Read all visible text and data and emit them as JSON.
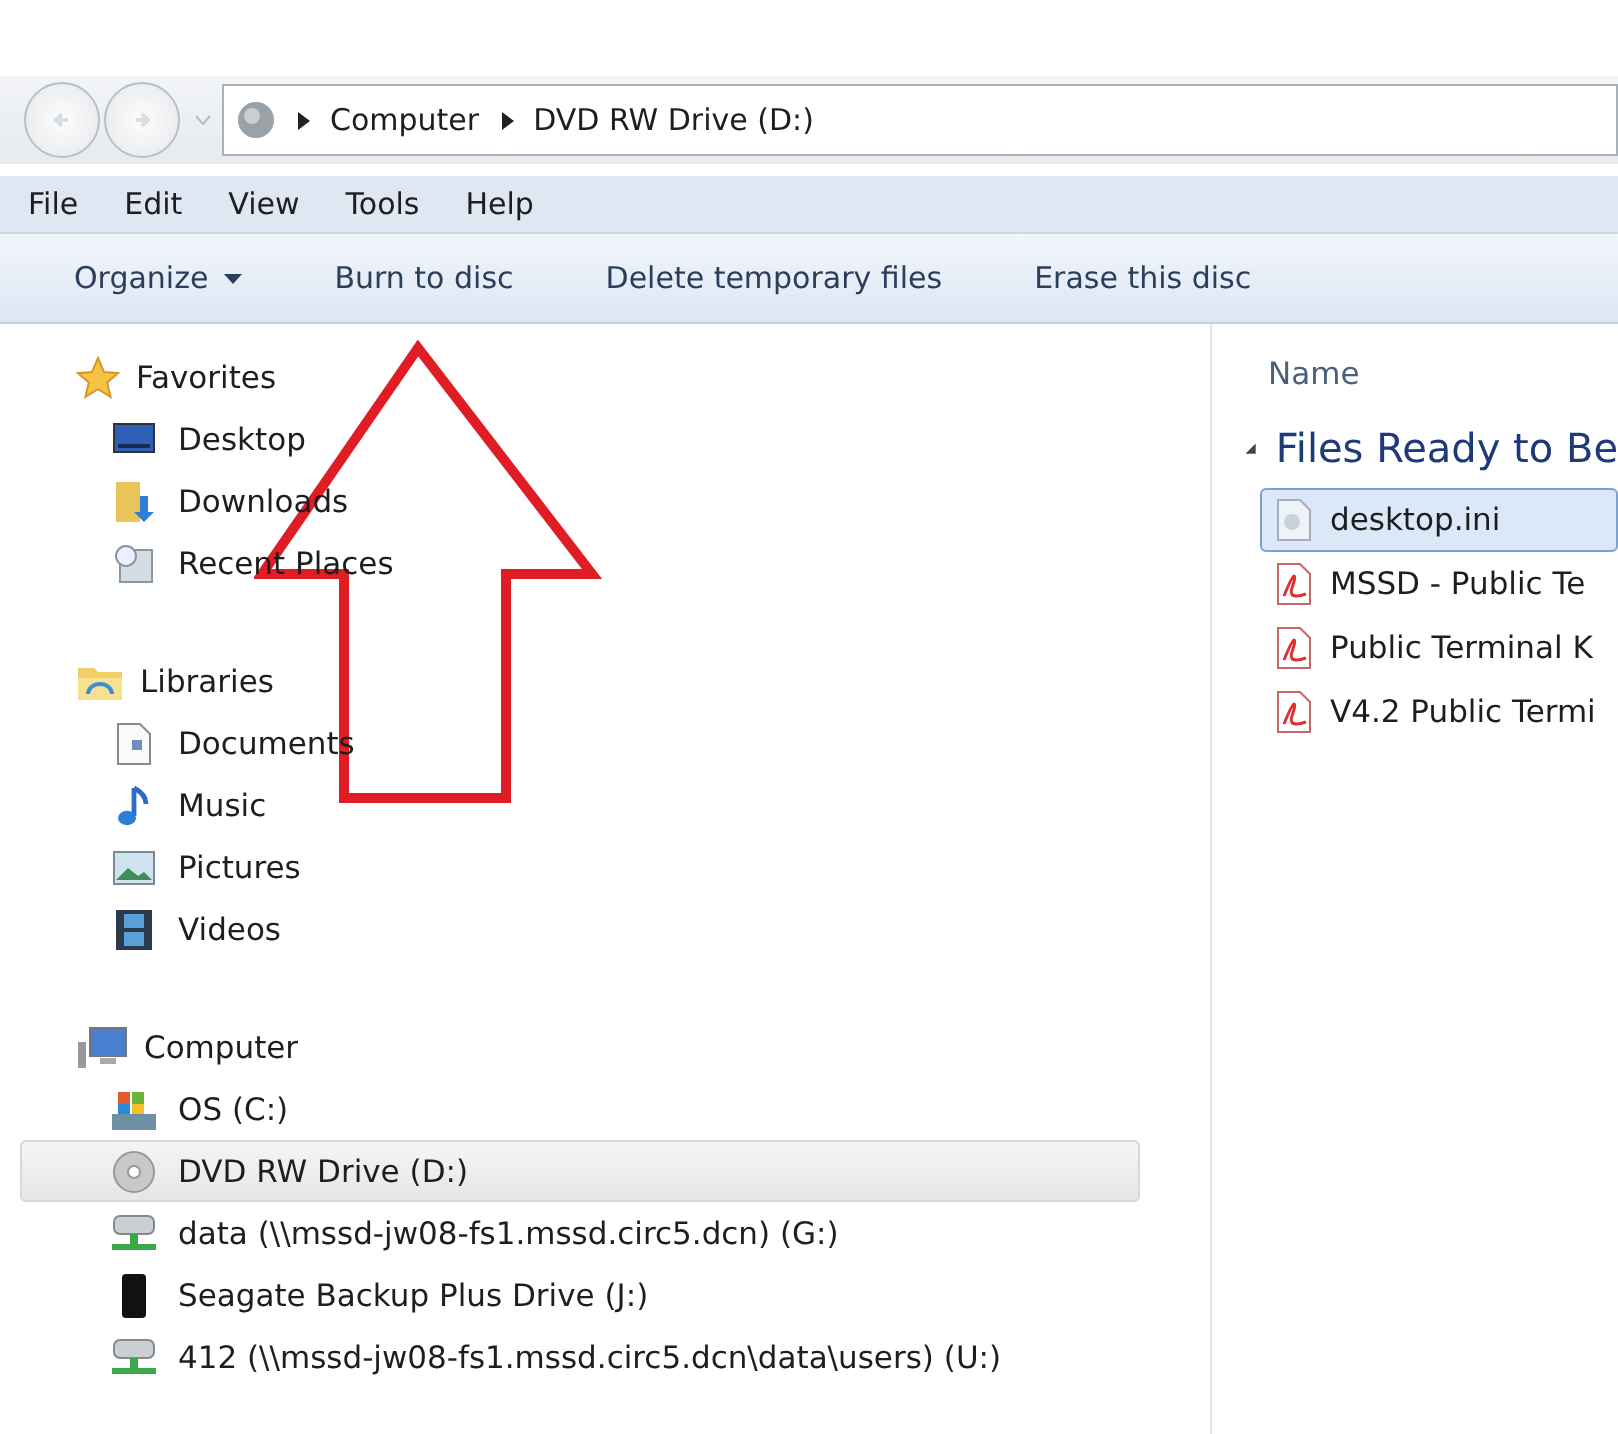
{
  "address_bar": {
    "crumbs": [
      "Computer",
      "DVD RW Drive (D:)"
    ]
  },
  "menu_bar": [
    "File",
    "Edit",
    "View",
    "Tools",
    "Help"
  ],
  "toolbar": [
    {
      "label": "Organize",
      "dropdown": true
    },
    {
      "label": "Burn to disc",
      "dropdown": false
    },
    {
      "label": "Delete temporary files",
      "dropdown": false
    },
    {
      "label": "Erase this disc",
      "dropdown": false
    }
  ],
  "sidebar": {
    "sections": [
      {
        "label": "Favorites",
        "children": [
          {
            "label": "Desktop",
            "selected": false
          },
          {
            "label": "Downloads",
            "selected": false
          },
          {
            "label": "Recent Places",
            "selected": false
          }
        ]
      },
      {
        "label": "Libraries",
        "children": [
          {
            "label": "Documents",
            "selected": false
          },
          {
            "label": "Music",
            "selected": false
          },
          {
            "label": "Pictures",
            "selected": false
          },
          {
            "label": "Videos",
            "selected": false
          }
        ]
      },
      {
        "label": "Computer",
        "children": [
          {
            "label": "OS (C:)",
            "selected": false
          },
          {
            "label": "DVD RW Drive (D:)",
            "selected": true
          },
          {
            "label": "data (\\\\mssd-jw08-fs1.mssd.circ5.dcn) (G:)",
            "selected": false
          },
          {
            "label": "Seagate Backup Plus Drive (J:)",
            "selected": false
          },
          {
            "label": "412 (\\\\mssd-jw08-fs1.mssd.circ5.dcn\\data\\users) (U:)",
            "selected": false
          }
        ]
      }
    ]
  },
  "file_list": {
    "columns": [
      "Name"
    ],
    "groups": [
      {
        "label": "Files Ready to Be",
        "expanded": true,
        "files": [
          {
            "name": "desktop.ini",
            "kind": "ini",
            "selected": true
          },
          {
            "name": "MSSD - Public Te",
            "kind": "pdf",
            "selected": false
          },
          {
            "name": "Public Terminal K",
            "kind": "pdf",
            "selected": false
          },
          {
            "name": "V4.2 Public Termi",
            "kind": "pdf",
            "selected": false
          }
        ]
      }
    ]
  }
}
